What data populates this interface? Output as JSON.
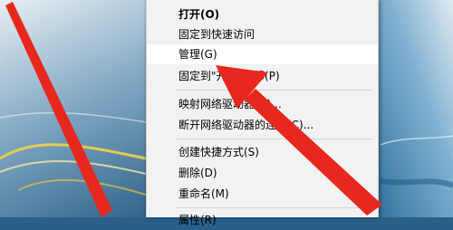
{
  "context_menu": {
    "items": [
      {
        "label": "打开(O)"
      },
      {
        "label": "固定到快速访问"
      },
      {
        "label": "管理(G)"
      },
      {
        "label": "固定到\"开始\"屏幕(P)"
      },
      {
        "label": "映射网络驱动器(N)..."
      },
      {
        "label": "断开网络驱动器的连接(C)..."
      },
      {
        "label": "创建快捷方式(S)"
      },
      {
        "label": "删除(D)"
      },
      {
        "label": "重命名(M)"
      },
      {
        "label": "属性(R)"
      }
    ]
  },
  "colors": {
    "menu_bg": "#f2f2f2",
    "highlight_bg": "#ffffff",
    "arrow": "#e8281e"
  }
}
